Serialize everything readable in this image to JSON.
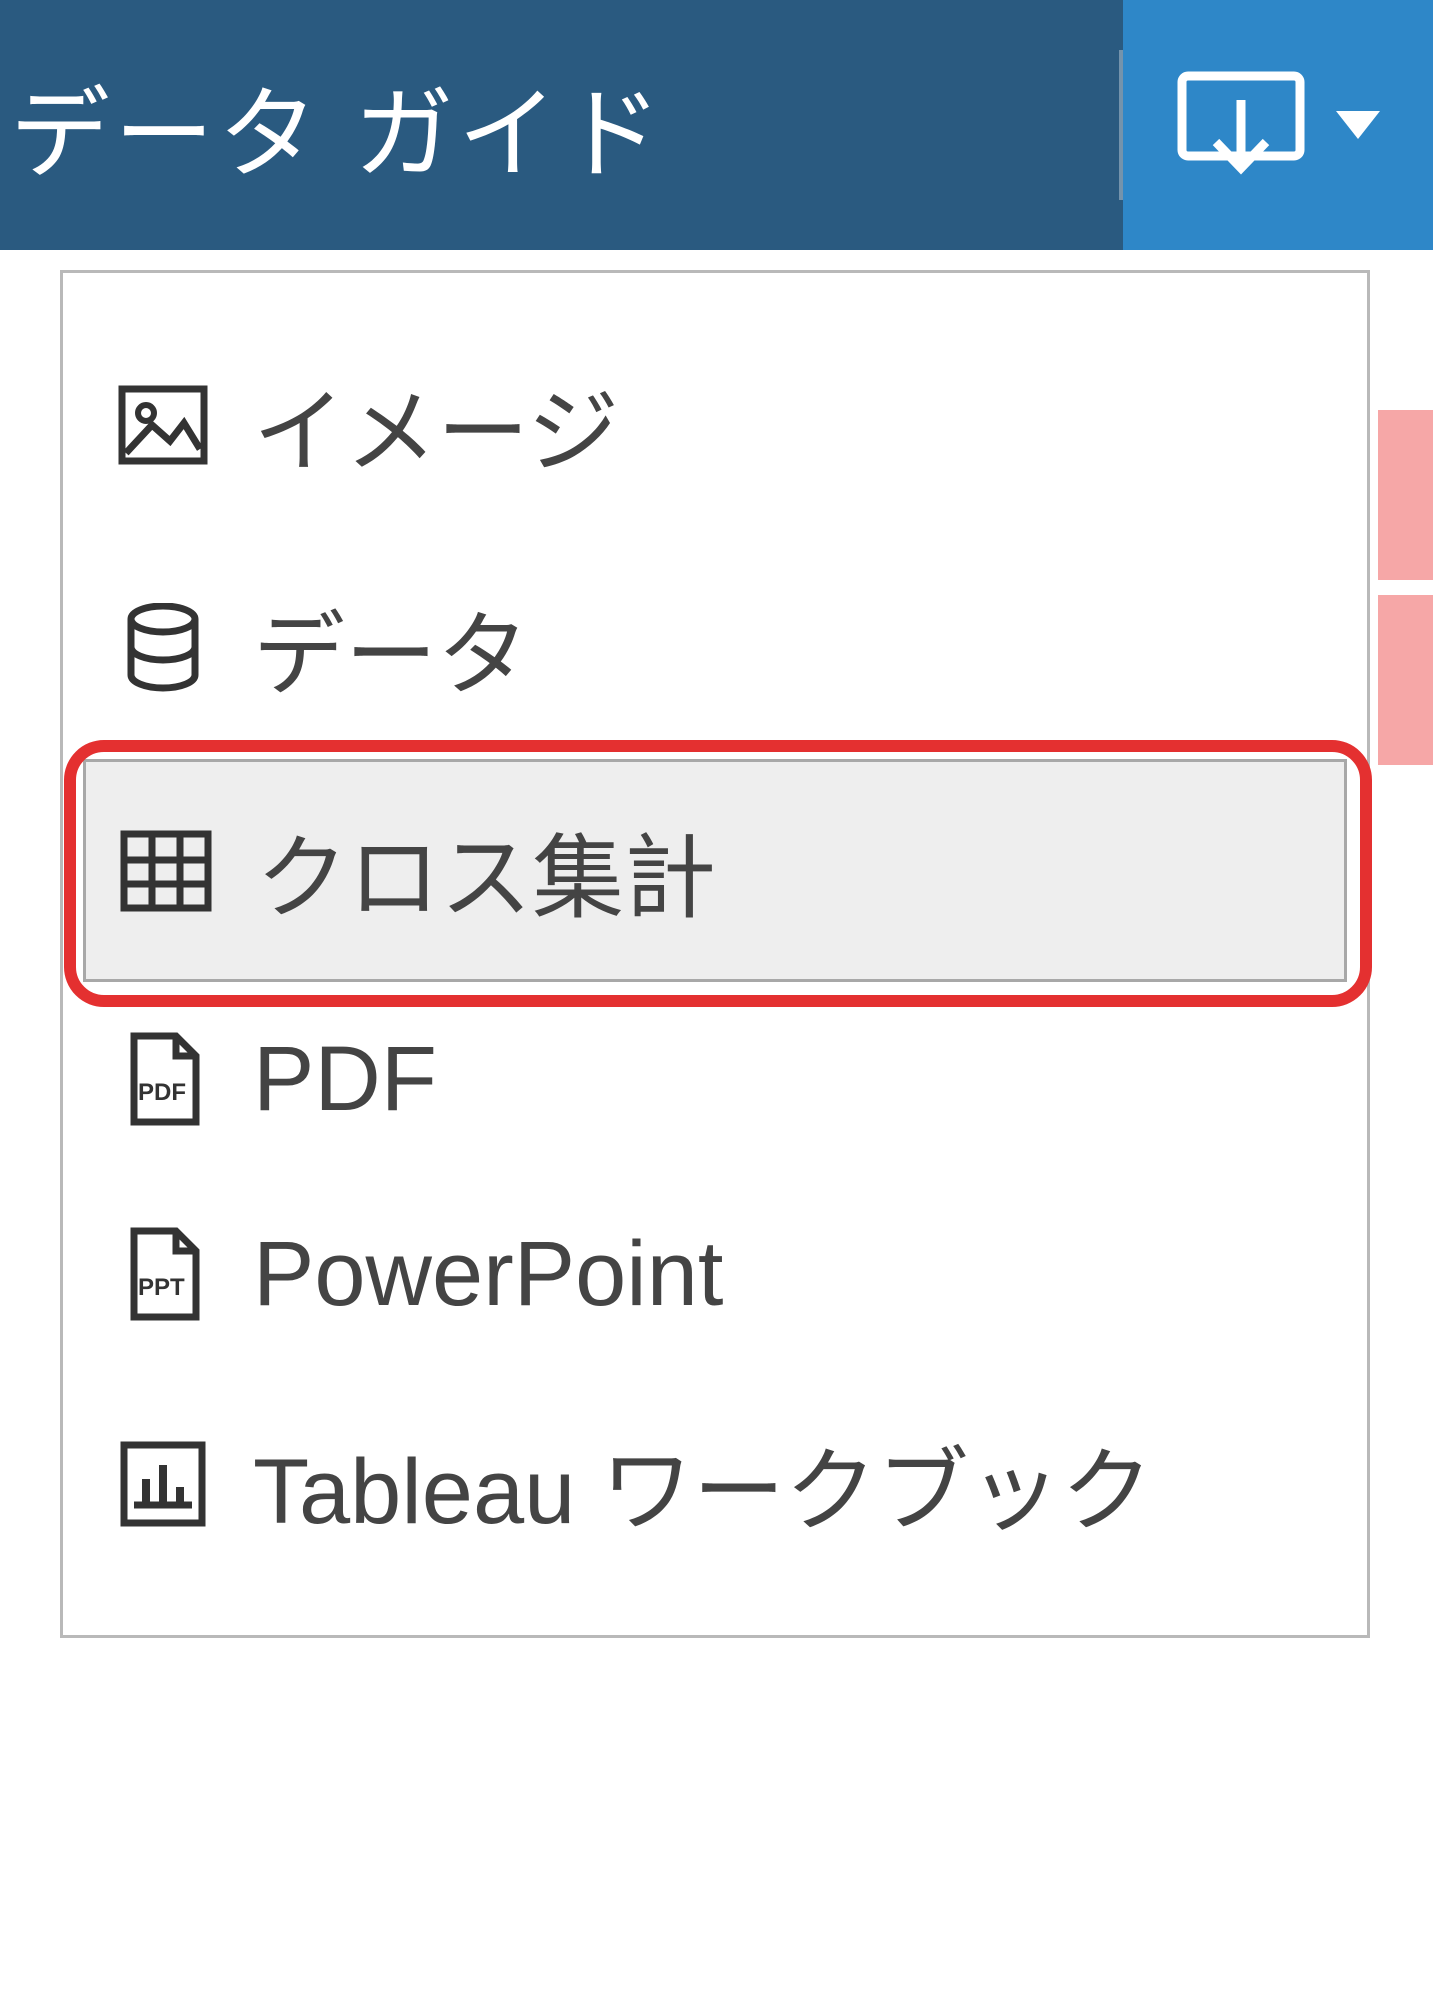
{
  "toolbar": {
    "title": "データ ガイド"
  },
  "menu": {
    "items": [
      {
        "label": "イメージ"
      },
      {
        "label": "データ"
      },
      {
        "label": "クロス集計"
      },
      {
        "label": "PDF"
      },
      {
        "label": "PowerPoint"
      },
      {
        "label": "Tableau ワークブック"
      }
    ]
  }
}
